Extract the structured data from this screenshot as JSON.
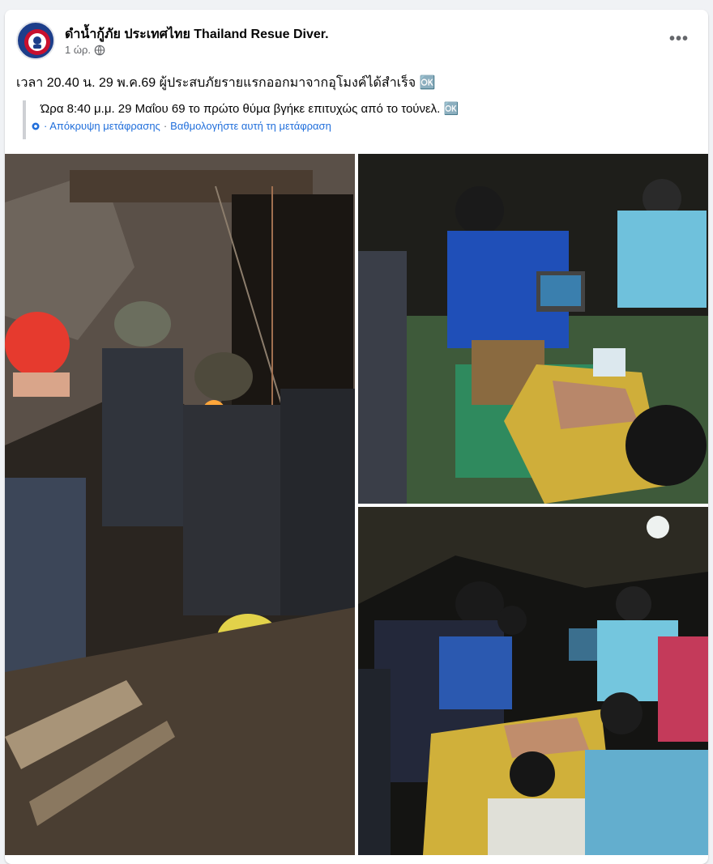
{
  "post": {
    "page_name": "ดำน้ำกู้ภัย ประเทศไทย Thailand Resue Diver.",
    "time": "1 ώρ.",
    "privacy_icon": "globe-icon",
    "more_icon": "more-options-icon",
    "more_label": "•••",
    "text": "เวลา 20.40 น. 29 พ.ค.69 ผู้ประสบภัยรายแรกออกมาจากอุโมงค์ได้สำเร็จ 🆗",
    "translation": {
      "text": "Ώρα 8:40 μ.μ. 29 Μαΐου 69 το πρώτο θύμα βγήκε επιτυχώς από το τούνελ. 🆗",
      "hide_link": "· Απόκρυψη μετάφρασης",
      "separator": "·",
      "rate_link": "Βαθμολογήστε αυτή τη μετάφραση",
      "icon": "gear-icon"
    },
    "photos": [
      {
        "name": "photo-rescuers-tunnel"
      },
      {
        "name": "photo-medics-treating"
      },
      {
        "name": "photo-medics-night"
      }
    ]
  },
  "colors": {
    "link": "#216fdb",
    "secondary_text": "#65676b",
    "avatar": "#1d3e8a"
  }
}
